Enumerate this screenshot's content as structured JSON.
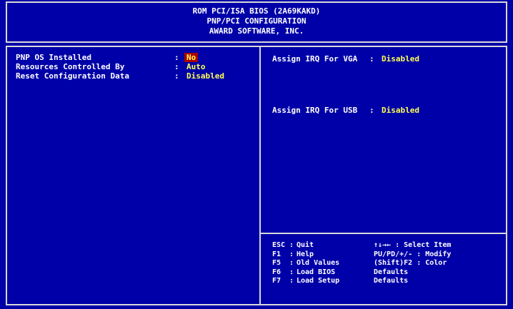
{
  "header": {
    "line1": "ROM PCI/ISA BIOS (2A69KAKD)",
    "line2": "PNP/PCI CONFIGURATION",
    "line3": "AWARD SOFTWARE, INC."
  },
  "settings": [
    {
      "label": "PNP OS Installed",
      "value": "No",
      "selected": true
    },
    {
      "label": "Resources Controlled By",
      "value": "Auto",
      "selected": false
    },
    {
      "label": "Reset Configuration Data",
      "value": "Disabled",
      "selected": false
    }
  ],
  "irq": [
    {
      "label": "Assign IRQ For VGA",
      "value": "Disabled"
    },
    {
      "label": "Assign IRQ For USB",
      "value": "Disabled"
    }
  ],
  "legend": [
    {
      "key": "ESC",
      "action": "Quit",
      "hint": "↑↓→← : Select Item"
    },
    {
      "key": "F1",
      "action": "Help",
      "hint": "PU/PD/+/- : Modify"
    },
    {
      "key": "F5",
      "action": "Old Values",
      "hint": "(Shift)F2 : Color"
    },
    {
      "key": "F6",
      "action": "Load BIOS",
      "hint": "Defaults"
    },
    {
      "key": "F7",
      "action": "Load Setup",
      "hint": "Defaults"
    }
  ],
  "colors": {
    "background": "#0000a8",
    "text": "#ffffff",
    "value": "#ffff54",
    "highlight": "#a80000",
    "border": "#d8d8d8"
  }
}
